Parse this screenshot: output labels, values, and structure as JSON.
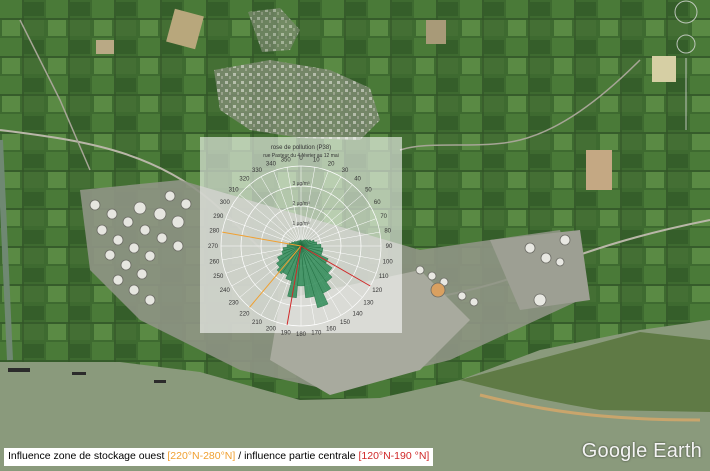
{
  "rose": {
    "title": "rose de pollution (P38)",
    "subtitle": "rue Pasteur du 4 février au 12 mai",
    "radial_unit": "µg/m³",
    "radial_labels": [
      "1 µg/m³",
      "2 µg/m³",
      "3 µg/m³"
    ],
    "direction_labels": [
      "0",
      "10",
      "20",
      "30",
      "40",
      "50",
      "60",
      "70",
      "80",
      "90",
      "100",
      "110",
      "120",
      "130",
      "140",
      "150",
      "160",
      "170",
      "180",
      "190",
      "200",
      "210",
      "220",
      "230",
      "240",
      "250",
      "260",
      "270",
      "280",
      "290",
      "300",
      "310",
      "320",
      "330",
      "340",
      "350"
    ],
    "chart_data": {
      "type": "polar-bar",
      "directions_deg": [
        0,
        10,
        20,
        30,
        40,
        50,
        60,
        70,
        80,
        90,
        100,
        110,
        120,
        130,
        140,
        150,
        160,
        170,
        180,
        190,
        200,
        210,
        220,
        230,
        240,
        250,
        260,
        270,
        280,
        290,
        300,
        310,
        320,
        330,
        340,
        350
      ],
      "values": [
        0.3,
        0.25,
        0.3,
        0.35,
        0.4,
        0.45,
        0.55,
        0.7,
        0.8,
        1.0,
        1.1,
        1.1,
        1.5,
        1.9,
        2.2,
        2.6,
        3.2,
        2.6,
        2.0,
        2.6,
        1.8,
        1.6,
        1.7,
        1.5,
        1.3,
        1.0,
        0.9,
        0.7,
        0.6,
        0.5,
        0.4,
        0.35,
        0.3,
        0.3,
        0.25,
        0.3
      ],
      "rmax": 4,
      "bar_color": "#2e8b57",
      "highlights": [
        {
          "sector": "220°N-280°N",
          "color": "#f0a030"
        },
        {
          "sector": "120°N-190°N",
          "color": "#d02828"
        }
      ]
    }
  },
  "caption": {
    "prefix": "Influence zone de stockage ouest ",
    "sector_west": "[220°N-280°N]",
    "middle": " / influence partie centrale ",
    "sector_central": "[120°N-190 °N]"
  },
  "branding": {
    "logo": "Google Earth"
  },
  "colors": {
    "water": "#8a9a7c",
    "field": "#3f6b2f",
    "orange": "#f0a030",
    "red": "#d02828"
  }
}
